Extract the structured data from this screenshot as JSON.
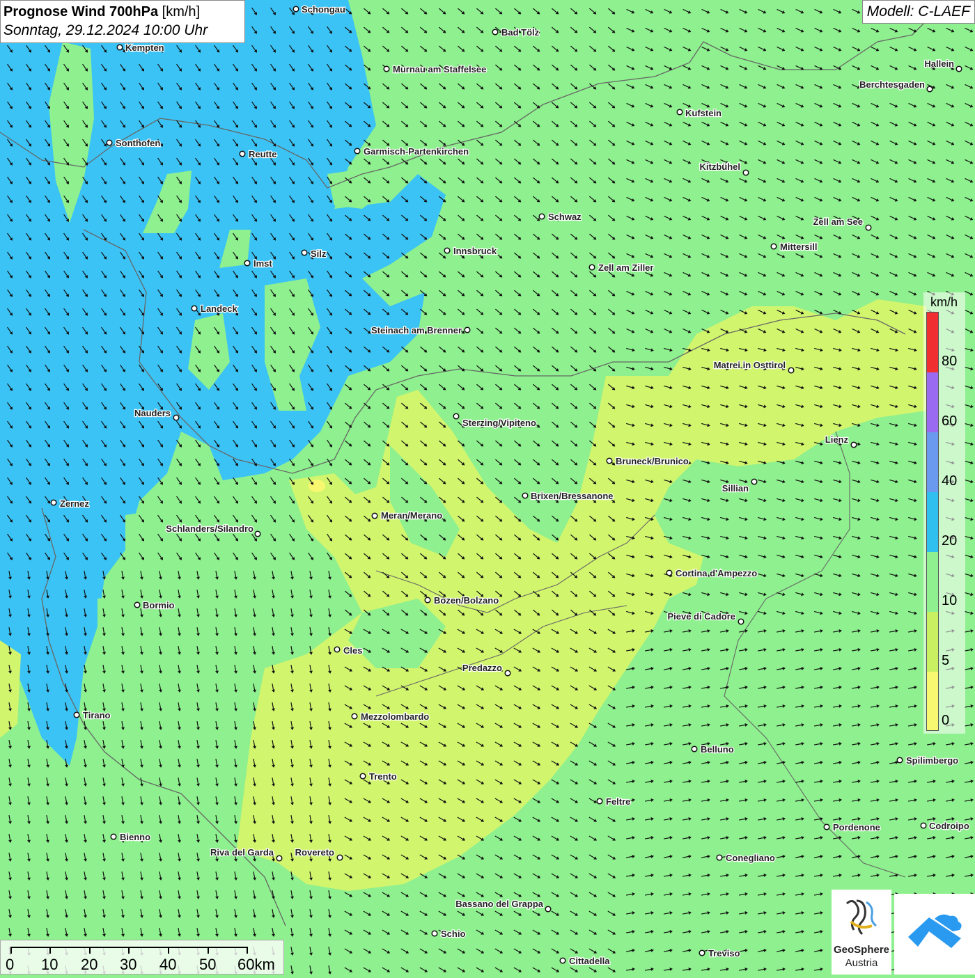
{
  "title": {
    "main": "Prognose Wind 700hPa",
    "unit": "[km/h]",
    "datetime": "Sonntag, 29.12.2024 10:00 Uhr"
  },
  "model": "Modell: C-LAEF",
  "legend": {
    "unit": "km/h",
    "labels": [
      "80",
      "60",
      "40",
      "20",
      "10",
      "5",
      "0"
    ],
    "colors": [
      "#f03030",
      "#9a6af0",
      "#6a9af0",
      "#30c0f0",
      "#8ef08e",
      "#c8f060",
      "#f8f870"
    ]
  },
  "scalebar": {
    "labels": [
      "0",
      "10",
      "20",
      "30",
      "40",
      "50",
      "60km"
    ]
  },
  "logos": {
    "geosphere_line1": "GeoSphere",
    "geosphere_line2": "Austria"
  },
  "cities": [
    {
      "name": "Schongau"
    },
    {
      "name": "Bad Tölz"
    },
    {
      "name": "Kempten"
    },
    {
      "name": "Murnau am Staffelsee"
    },
    {
      "name": "Hallein"
    },
    {
      "name": "Berchtesgaden"
    },
    {
      "name": "Kufstein"
    },
    {
      "name": "Sonthofen"
    },
    {
      "name": "Reutte"
    },
    {
      "name": "Garmisch-Partenkirchen"
    },
    {
      "name": "Kitzbühel"
    },
    {
      "name": "Schwaz"
    },
    {
      "name": "Zell am See"
    },
    {
      "name": "Innsbruck"
    },
    {
      "name": "Mittersill"
    },
    {
      "name": "Imst"
    },
    {
      "name": "Silz"
    },
    {
      "name": "Zell am Ziller"
    },
    {
      "name": "Landeck"
    },
    {
      "name": "Steinach am Brenner"
    },
    {
      "name": "Matrei in Osttirol"
    },
    {
      "name": "Nauders"
    },
    {
      "name": "Sterzing/Vipiteno"
    },
    {
      "name": "Lienz"
    },
    {
      "name": "Bruneck/Brunico"
    },
    {
      "name": "Sillian"
    },
    {
      "name": "Brixen/Bressanone"
    },
    {
      "name": "Zernez"
    },
    {
      "name": "Meran/Merano"
    },
    {
      "name": "Schlanders/Silandro"
    },
    {
      "name": "Cortina d'Ampezzo"
    },
    {
      "name": "Bozen/Bolzano"
    },
    {
      "name": "Bormio"
    },
    {
      "name": "Pieve di Cadore"
    },
    {
      "name": "Cles"
    },
    {
      "name": "Predazzo"
    },
    {
      "name": "Tirano"
    },
    {
      "name": "Mezzolombardo"
    },
    {
      "name": "Belluno"
    },
    {
      "name": "Spilimbergo"
    },
    {
      "name": "Trento"
    },
    {
      "name": "Feltre"
    },
    {
      "name": "Pordenone"
    },
    {
      "name": "Codroipo"
    },
    {
      "name": "Bienno"
    },
    {
      "name": "Riva del Garda"
    },
    {
      "name": "Rovereto"
    },
    {
      "name": "Conegliano"
    },
    {
      "name": "Bassano del Grappa"
    },
    {
      "name": "Schio"
    },
    {
      "name": "Treviso"
    },
    {
      "name": "Cittadella"
    }
  ]
}
